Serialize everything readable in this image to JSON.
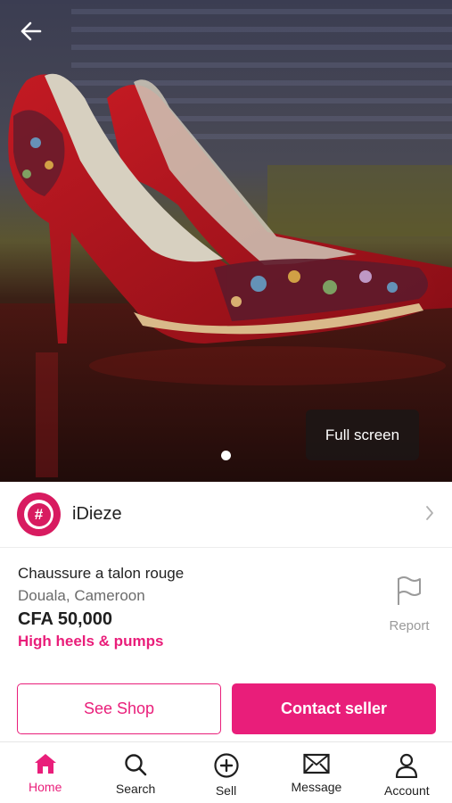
{
  "hero": {
    "fullscreen_label": "Full screen",
    "image_count": 1,
    "active_image": 1,
    "icons": {
      "back": "back-arrow-icon"
    }
  },
  "seller": {
    "name": "iDieze",
    "avatar_glyph": "#",
    "icons": {
      "chevron": "chevron-right-icon"
    }
  },
  "listing": {
    "title": "Chaussure a talon rouge",
    "location": "Douala, Cameroon",
    "price": "CFA 50,000",
    "category": "High heels & pumps"
  },
  "report": {
    "label": "Report",
    "icon": "flag-icon"
  },
  "actions": {
    "see_shop": "See Shop",
    "contact_seller": "Contact seller"
  },
  "nav": {
    "items": [
      {
        "label": "Home",
        "icon": "home-icon",
        "active": true
      },
      {
        "label": "Search",
        "icon": "search-icon",
        "active": false
      },
      {
        "label": "Sell",
        "icon": "plus-circle-icon",
        "active": false
      },
      {
        "label": "Message",
        "icon": "envelope-icon",
        "active": false
      },
      {
        "label": "Account",
        "icon": "person-icon",
        "active": false
      }
    ]
  },
  "colors": {
    "accent": "#e91e7a",
    "avatar": "#d81b60",
    "text_primary": "#1f1f1f",
    "text_secondary": "#6b6b6b",
    "text_muted": "#9a9a9a"
  }
}
